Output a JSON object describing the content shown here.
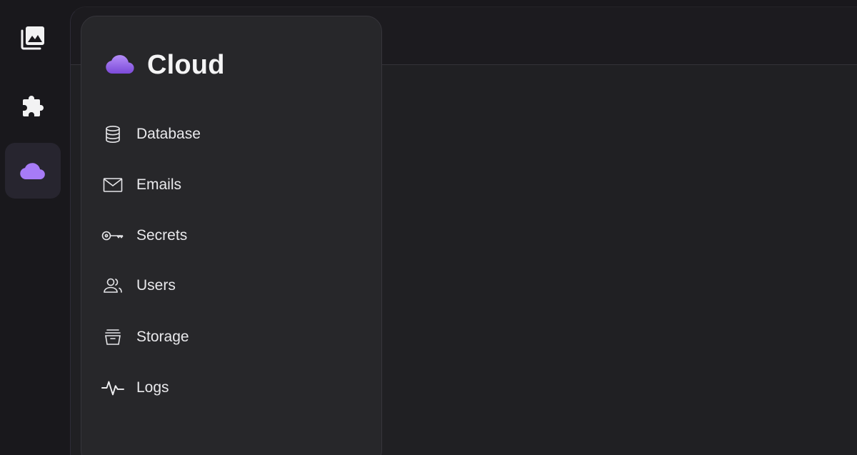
{
  "rail": {
    "items": [
      {
        "icon": "photo-library-icon",
        "active": false
      },
      {
        "icon": "puzzle-icon",
        "active": false
      },
      {
        "icon": "cloud-icon",
        "active": true
      }
    ]
  },
  "panel": {
    "title": "Cloud",
    "logo_icon": "cloud-icon",
    "accent": "#8b5cf6",
    "items": [
      {
        "label": "Database",
        "icon": "database-icon"
      },
      {
        "label": "Emails",
        "icon": "mail-icon"
      },
      {
        "label": "Secrets",
        "icon": "key-icon"
      },
      {
        "label": "Users",
        "icon": "users-icon"
      },
      {
        "label": "Storage",
        "icon": "storage-icon"
      },
      {
        "label": "Logs",
        "icon": "activity-icon"
      }
    ]
  }
}
